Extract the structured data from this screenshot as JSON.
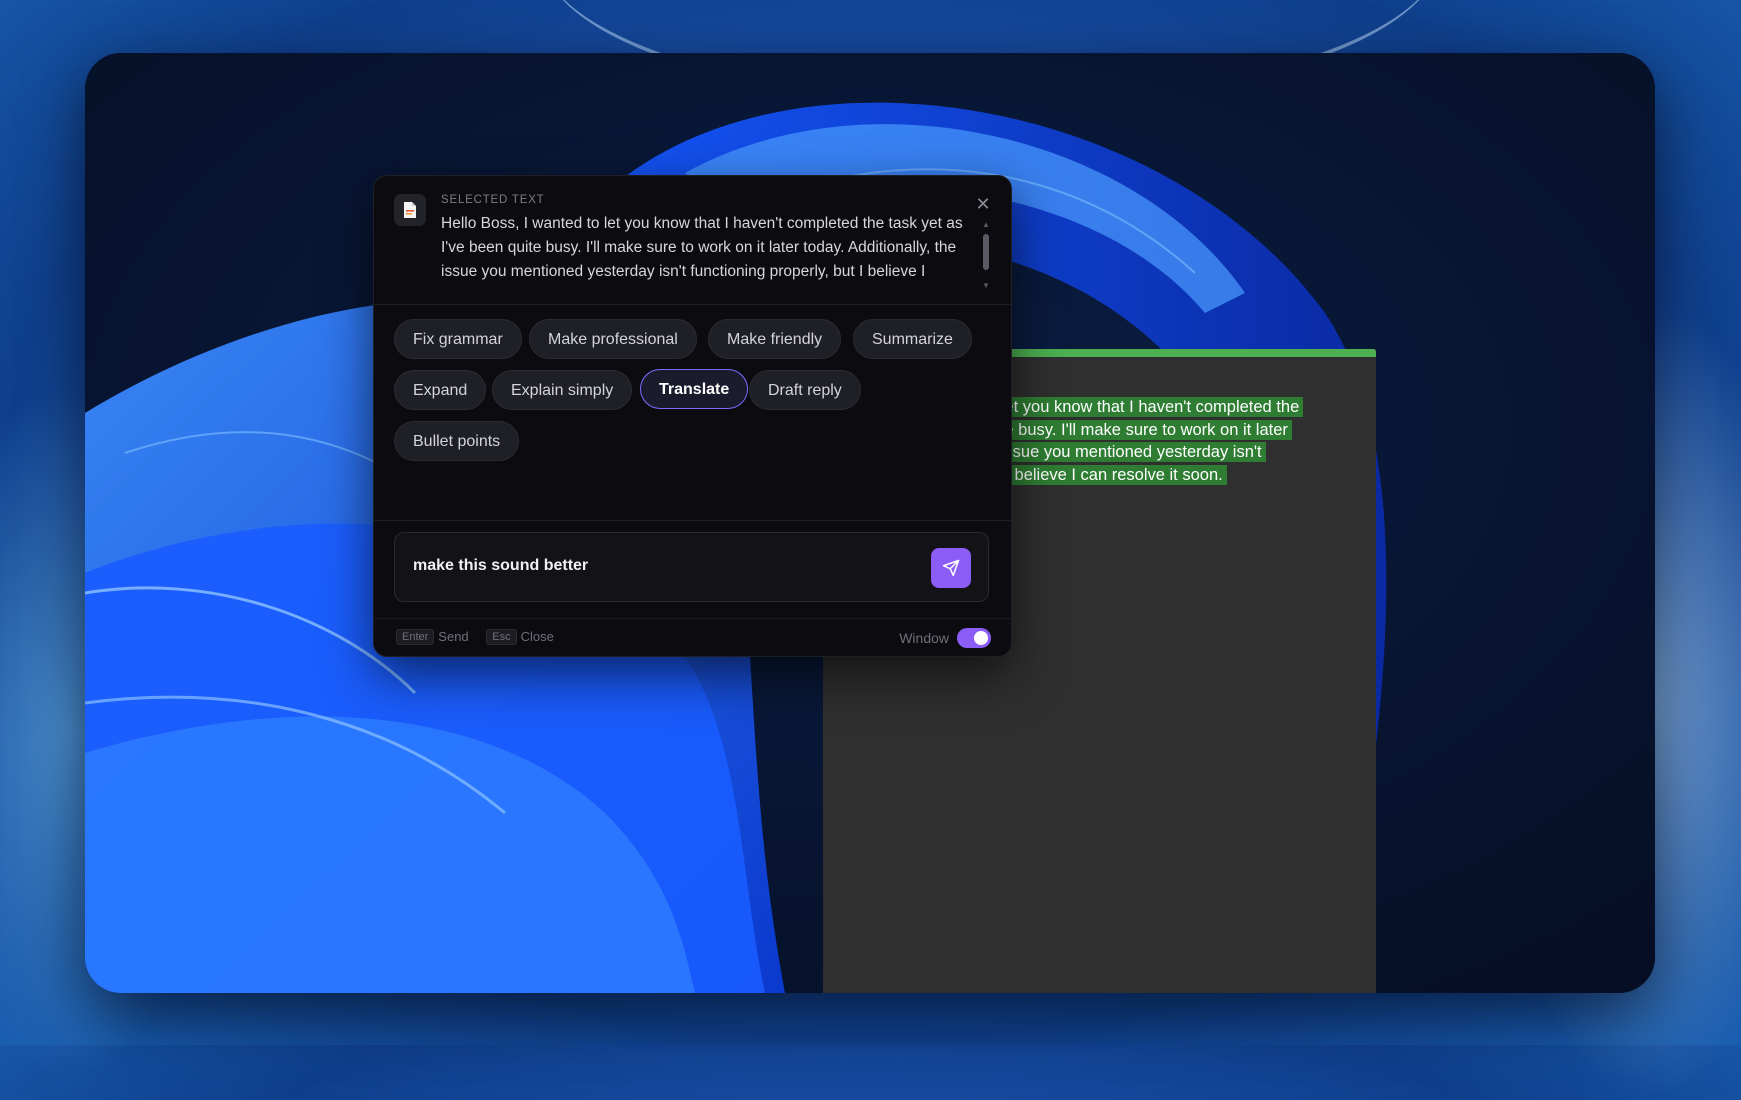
{
  "popup": {
    "selected_label": "SELECTED TEXT",
    "selected_text": "Hello Boss, I wanted to let you know that I haven't completed the task yet as I've been quite busy. I'll make sure to work on it later today. Additionally, the issue you mentioned yesterday isn't functioning properly, but I believe I",
    "close_icon": "close-icon",
    "actions": [
      {
        "label": "Fix grammar",
        "active": false
      },
      {
        "label": "Make professional",
        "active": false
      },
      {
        "label": "Make friendly",
        "active": false
      },
      {
        "label": "Summarize",
        "active": false
      },
      {
        "label": "Expand",
        "active": false
      },
      {
        "label": "Explain simply",
        "active": false
      },
      {
        "label": "Translate",
        "active": true
      },
      {
        "label": "Draft reply",
        "active": false
      },
      {
        "label": "Bullet points",
        "active": false
      }
    ],
    "input_value": "make this sound better",
    "send_icon": "send-icon",
    "footer": {
      "enter_key": "Enter",
      "enter_hint": "Send",
      "esc_key": "Esc",
      "esc_hint": "Close",
      "window_label": "Window",
      "window_toggle_on": true
    },
    "accent_color": "#8b5cf6"
  },
  "notepad": {
    "lines": [
      "o let you know that I haven't completed the",
      "uite busy. I'll make sure to work on it later",
      "e issue you mentioned yesterday isn't",
      "ut I believe I can resolve it soon."
    ],
    "highlight_color": "#2e7d32",
    "bar_color": "#4caf50"
  }
}
